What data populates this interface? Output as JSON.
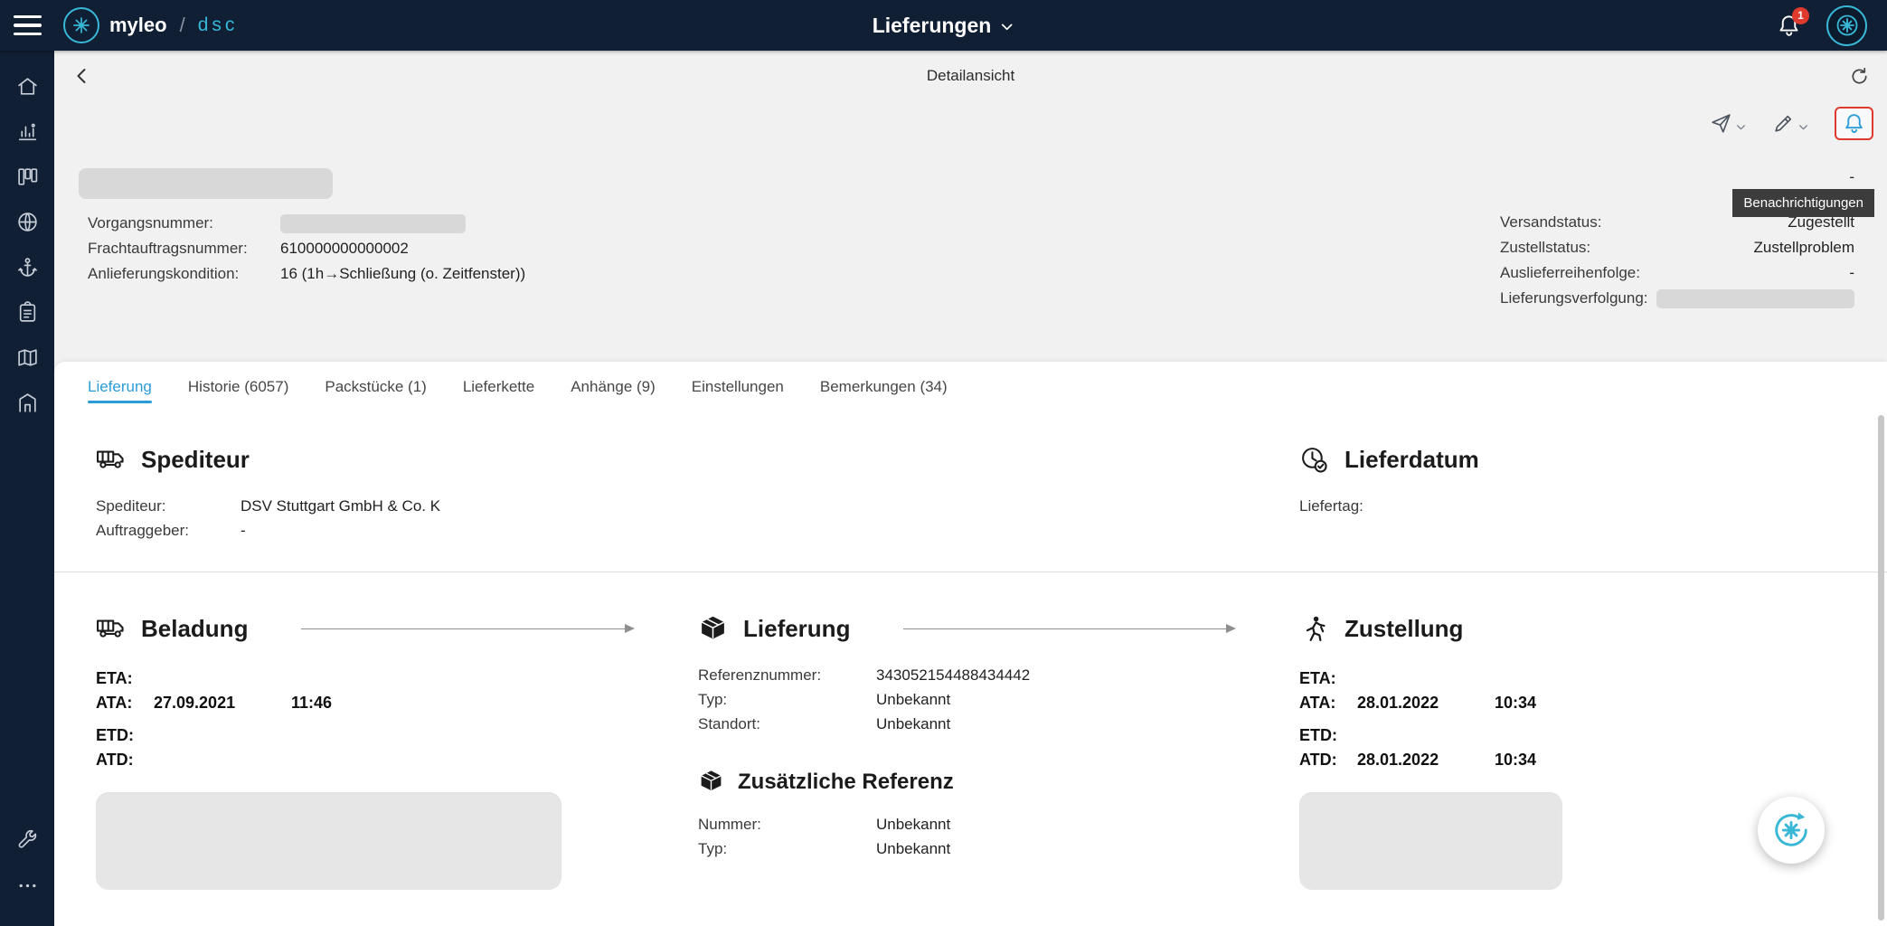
{
  "colors": {
    "navy": "#101f33",
    "accent": "#2b9cd8",
    "teal": "#38b7d6",
    "red": "#df3a2e",
    "page_bg": "#f1f1f2",
    "card_bg": "#ffffff",
    "tooltip_bg": "#3c3c3c",
    "redact": "#d8d8d8",
    "blob": "#e6e6e6",
    "icon_muted": "#c7cdd7",
    "divider": "#dcdcdc",
    "label": "#3a3a3a",
    "text": "#1f1f1f"
  },
  "topbar": {
    "brand": {
      "name": "myleo",
      "sep": "/",
      "sub": "dsc"
    },
    "title": "Lieferungen",
    "badge": "1"
  },
  "subheader": {
    "title": "Detailansicht"
  },
  "toolbar": {
    "tooltip": "Benachrichtigungen"
  },
  "info": {
    "left": [
      {
        "label": "Vorgangsnummer:",
        "value": ""
      },
      {
        "label": "Frachtauftragsnummer:",
        "value": "610000000000002"
      },
      {
        "label": "Anlieferungskondition:",
        "value": "16 (1h→Schließung (o. Zeitfenster))"
      }
    ],
    "right_top": "-",
    "right": [
      {
        "label": "Versandstatus:",
        "value": "Zugestellt"
      },
      {
        "label": "Zustellstatus:",
        "value": "Zustellproblem"
      },
      {
        "label": "Auslieferreihenfolge:",
        "value": "-"
      },
      {
        "label": "Lieferungsverfolgung:",
        "value": ""
      }
    ]
  },
  "tabs": [
    {
      "label": "Lieferung",
      "active": true
    },
    {
      "label": "Historie (6057)"
    },
    {
      "label": "Packstücke (1)"
    },
    {
      "label": "Lieferkette"
    },
    {
      "label": "Anhänge (9)"
    },
    {
      "label": "Einstellungen"
    },
    {
      "label": "Bemerkungen (34)"
    }
  ],
  "sections": {
    "spediteur": {
      "title": "Spediteur",
      "fields": [
        {
          "label": "Spediteur:",
          "value": "DSV Stuttgart GmbH & Co. K"
        },
        {
          "label": "Auftraggeber:",
          "value": "-"
        }
      ]
    },
    "lieferdatum": {
      "title": "Lieferdatum",
      "fields": [
        {
          "label": "Liefertag:",
          "value": ""
        }
      ]
    },
    "beladung": {
      "title": "Beladung",
      "rows": [
        {
          "label": "ETA:",
          "date": "",
          "time": ""
        },
        {
          "label": "ATA:",
          "date": "27.09.2021",
          "time": "11:46"
        },
        {
          "label": "ETD:",
          "date": "",
          "time": ""
        },
        {
          "label": "ATD:",
          "date": "",
          "time": ""
        }
      ]
    },
    "lieferung": {
      "title": "Lieferung",
      "fields": [
        {
          "label": "Referenznummer:",
          "value": "343052154488434442"
        },
        {
          "label": "Typ:",
          "value": "Unbekannt"
        },
        {
          "label": "Standort:",
          "value": "Unbekannt"
        }
      ],
      "zusatz": {
        "title": "Zusätzliche Referenz",
        "fields": [
          {
            "label": "Nummer:",
            "value": "Unbekannt"
          },
          {
            "label": "Typ:",
            "value": "Unbekannt"
          }
        ]
      }
    },
    "zustellung": {
      "title": "Zustellung",
      "rows": [
        {
          "label": "ETA:",
          "date": "",
          "time": ""
        },
        {
          "label": "ATA:",
          "date": "28.01.2022",
          "time": "10:34"
        },
        {
          "label": "ETD:",
          "date": "",
          "time": ""
        },
        {
          "label": "ATD:",
          "date": "28.01.2022",
          "time": "10:34"
        }
      ]
    }
  },
  "icons": {
    "menu-icon": "hamburger",
    "brand-mark-icon": "compass-star",
    "chevron-down-icon": "chevron-down",
    "bell-icon": "bell",
    "user-avatar-icon": "compass-star",
    "back-icon": "chevron-left",
    "refresh-icon": "circular-arrow",
    "send-icon": "paper-plane",
    "edit-icon": "pencil",
    "home-icon": "house",
    "analytics-icon": "bar-chart",
    "board-icon": "columns",
    "globe-icon": "globe",
    "anchor-icon": "anchor",
    "tasks-icon": "clipboard",
    "map-icon": "folded-map",
    "warehouse-icon": "house-door",
    "settings-icon": "wrench",
    "more-icon": "ellipsis",
    "truck-icon": "truck",
    "clock-check-icon": "clock-check",
    "package-icon": "cube",
    "courier-icon": "delivery-person",
    "assistant-icon": "sync-star"
  }
}
